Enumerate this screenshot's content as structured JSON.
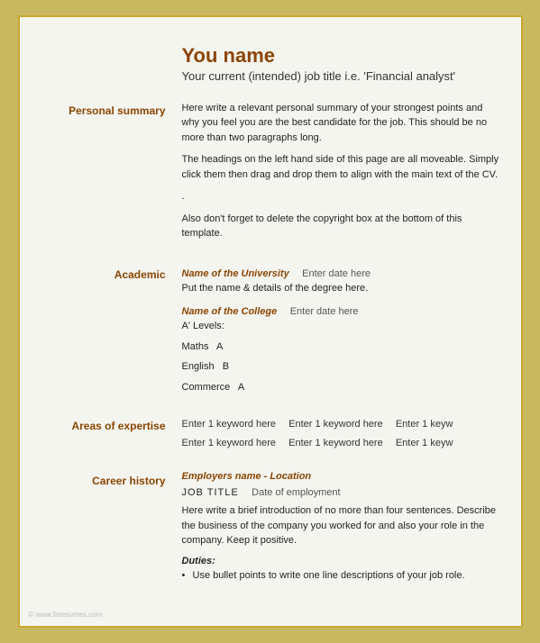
{
  "header": {
    "name": "You name",
    "job_title": "Your current (intended) job title i.e. 'Financial analyst'"
  },
  "sections": {
    "personal_summary": {
      "label": "Personal summary",
      "paragraphs": [
        "Here write a relevant personal summary of your strongest points and why you feel you are the best candidate for the job. This should be no more than two paragraphs long.",
        "The headings on the left hand side of this page are all moveable. Simply click them then drag and drop them to align with the main text of the CV.",
        ".",
        "Also don't forget to delete the copyright box at the bottom of this template."
      ]
    },
    "academic": {
      "label": "Academic",
      "university": {
        "name": "Name of the University",
        "date": "Enter date here",
        "detail": "Put the name & details of the degree here."
      },
      "college": {
        "name": "Name of the College",
        "date": "Enter date here",
        "levels_label": "A' Levels:",
        "subjects": [
          {
            "subject": "Maths",
            "grade": "A"
          },
          {
            "subject": "English",
            "grade": "B"
          },
          {
            "subject": "Commerce",
            "grade": "A"
          }
        ]
      }
    },
    "areas_of_expertise": {
      "label": "Areas of expertise",
      "keywords": [
        "Enter 1 keyword here",
        "Enter 1 keyword here",
        "Enter 1 keyw",
        "Enter 1 keyword here",
        "Enter 1 keyword here",
        "Enter 1 keyw"
      ]
    },
    "career_history": {
      "label": "Career history",
      "employer": {
        "name": "Employers name - Location",
        "job_title": "JOB TITLE",
        "employment_date_label": "Date of employment",
        "intro": "Here write a brief introduction of no more than four sentences. Describe the business of the company you worked for and also your role in the company. Keep it positive.",
        "duties_label": "Duties:",
        "bullet_points": [
          "Use bullet points to write one line descriptions of your job role."
        ]
      }
    }
  },
  "watermark": {
    "text": "© www.freesumes.com"
  }
}
